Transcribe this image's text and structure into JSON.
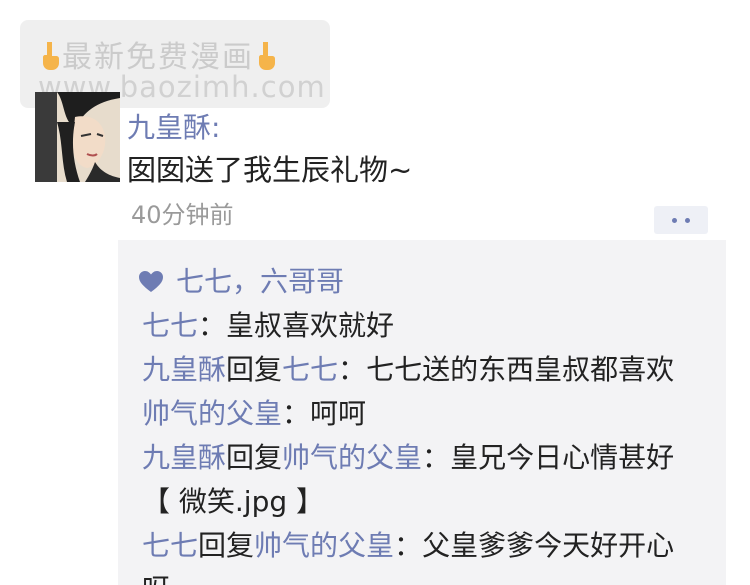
{
  "watermark": {
    "line1": "最新免费漫画",
    "line2": "www.baozimh.com"
  },
  "post": {
    "author": "九皇酥:",
    "text": "囡囡送了我生辰礼物~",
    "time": "40分钟前"
  },
  "likes": {
    "names": "七七，六哥哥"
  },
  "comments": [
    {
      "name": "七七",
      "sep": "：",
      "text": "皇叔喜欢就好"
    },
    {
      "name": "九皇酥",
      "reply": "回复",
      "target": "七七",
      "sep": "：",
      "text": "七七送的东西皇叔都喜欢"
    },
    {
      "name": "帅气的父皇",
      "sep": "：",
      "text": "呵呵"
    },
    {
      "name": "九皇酥",
      "reply": "回复",
      "target": "帅气的父皇",
      "sep": "：",
      "text": "皇兄今日心情甚好",
      "cont": "【 微笑.jpg 】"
    },
    {
      "name": "七七",
      "reply": "回复",
      "target": "帅气的父皇",
      "sep": "：",
      "text": "父皇爹爹今天好开心",
      "cont": "呀~"
    }
  ],
  "colors": {
    "name_link": "#6e7cb3",
    "text": "#222222",
    "time": "#9a9a9a",
    "comment_bg": "#f3f3f5"
  }
}
